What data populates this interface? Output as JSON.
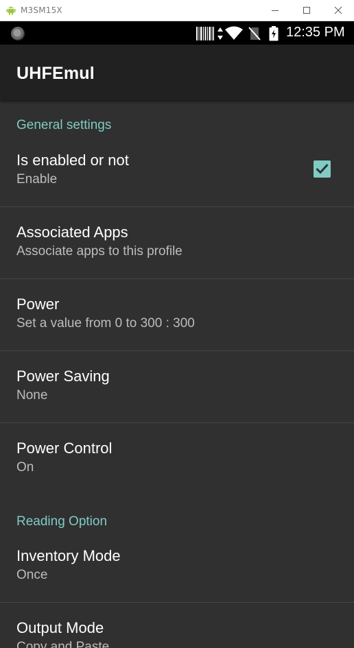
{
  "window": {
    "title": "M3SM15X",
    "app_icon": "android-icon",
    "controls": [
      "minimize-icon",
      "maximize-icon",
      "close-icon"
    ]
  },
  "statusbar": {
    "time": "12:35 PM",
    "icons": [
      "app-notification-icon",
      "barcode-icon",
      "data-transfer-icon",
      "wifi-icon",
      "no-sim-icon",
      "battery-charging-icon"
    ]
  },
  "appbar": {
    "title": "UHFEmul"
  },
  "sections": {
    "general": {
      "header": "General settings",
      "items": [
        {
          "title": "Is enabled or not",
          "summary": "Enable",
          "checked": true
        },
        {
          "title": "Associated Apps",
          "summary": "Associate apps to this profile"
        },
        {
          "title": "Power",
          "summary": "Set a value from 0 to 300 : 300"
        },
        {
          "title": "Power Saving",
          "summary": "None"
        },
        {
          "title": "Power Control",
          "summary": "On"
        }
      ]
    },
    "reading": {
      "header": "Reading Option",
      "items": [
        {
          "title": "Inventory Mode",
          "summary": "Once"
        },
        {
          "title": "Output Mode",
          "summary": "Copy and Paste"
        }
      ]
    }
  },
  "colors": {
    "accent": "#80cbc4",
    "background": "#303030",
    "appbar": "#212121",
    "statusbar": "#000000"
  }
}
